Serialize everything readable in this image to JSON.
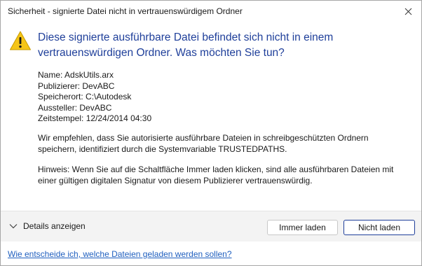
{
  "window": {
    "title": "Sicherheit - signierte Datei nicht in vertrauenswürdigem Ordner"
  },
  "dialog": {
    "headline": "Diese signierte ausführbare Datei befindet sich nicht in einem vertrauenswürdigen Ordner. Was möchten Sie tun?",
    "icon": "warning-icon",
    "info": {
      "name": "Name: AdskUtils.arx",
      "publisher": "Publizierer: DevABC",
      "location": "Speicherort: C:\\Autodesk",
      "issuer": "Aussteller: DevABC",
      "timestamp": "Zeitstempel: 12/24/2014 04:30"
    },
    "recommendation": "Wir empfehlen, dass Sie autorisierte ausführbare Dateien in schreibgeschützten Ordnern speichern, identifiziert durch die Systemvariable TRUSTEDPATHS.",
    "hint": "Hinweis: Wenn Sie auf die Schaltfläche Immer laden klicken, sind alle ausführbaren Dateien mit einer gültigen digitalen Signatur von diesem Publizierer vertrauenswürdig."
  },
  "footer": {
    "details_label": "Details anzeigen",
    "always_load_label": "Immer laden",
    "do_not_load_label": "Nicht laden",
    "help_link": "Wie entscheide ich, welche Dateien geladen werden sollen?"
  },
  "colors": {
    "headline": "#1f3f9a",
    "link": "#1f5fbf",
    "warning_fill": "#f5c518",
    "footer_bg": "#f3f3f3"
  }
}
